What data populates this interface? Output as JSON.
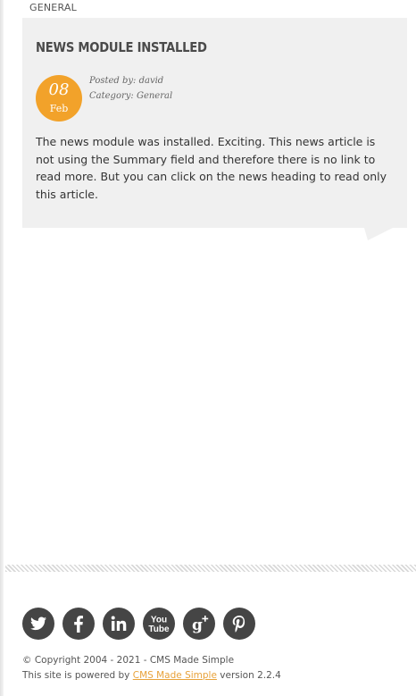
{
  "tab": {
    "label": "GENERAL"
  },
  "article": {
    "title": "NEWS MODULE INSTALLED",
    "date_day": "08",
    "date_month": "Feb",
    "posted_by": "Posted by: david",
    "category": "Category: General",
    "body": "The news module was installed. Exciting. This news article is not using the Summary field and therefore there is no link to read more. But you can click on the news heading to read only this article."
  },
  "social": [
    {
      "icon": "twitter-icon"
    },
    {
      "icon": "facebook-icon"
    },
    {
      "icon": "linkedin-icon"
    },
    {
      "icon": "youtube-icon"
    },
    {
      "icon": "google-plus-icon"
    },
    {
      "icon": "pinterest-icon"
    }
  ],
  "footer": {
    "copyright": "© Copyright 2004 - 2021 - CMS Made Simple",
    "powered_prefix": "This site is powered by",
    "powered_link": "CMS Made Simple",
    "powered_suffix": "version 2.2.4"
  },
  "colors": {
    "accent": "#f2a22a",
    "panel": "#f0f0f0",
    "icon": "#454545",
    "link": "#e8a23a"
  }
}
